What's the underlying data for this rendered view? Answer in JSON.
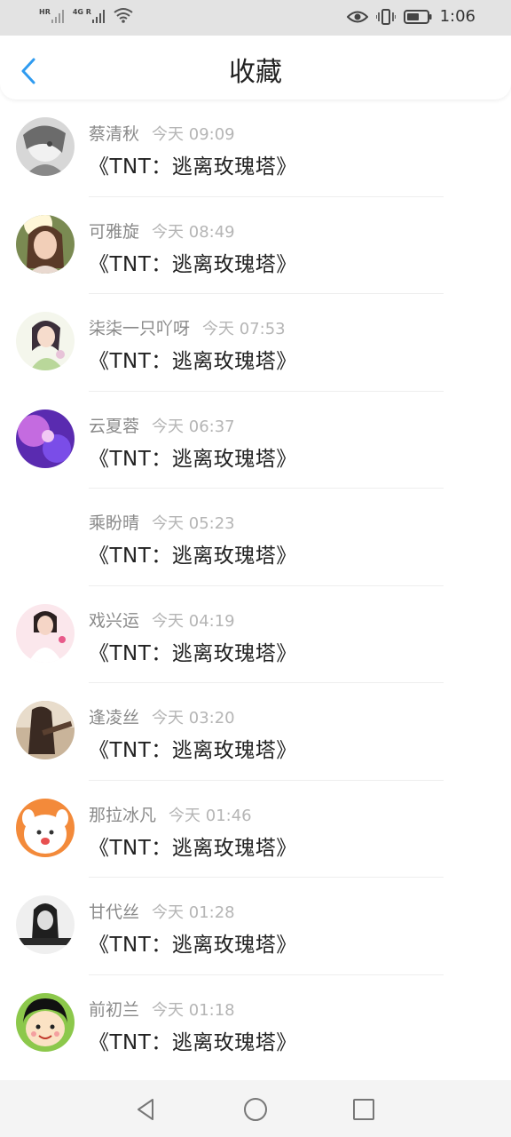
{
  "status": {
    "signal1_label": "HR",
    "signal2_label": "4G R",
    "time": "1:06"
  },
  "header": {
    "title": "收藏"
  },
  "items": [
    {
      "name": "蔡清秋",
      "time": "今天 09:09",
      "book": "《TNT：逃离玫瑰塔》"
    },
    {
      "name": "可雅旋",
      "time": "今天 08:49",
      "book": "《TNT：逃离玫瑰塔》"
    },
    {
      "name": "柒柒一只吖呀",
      "time": "今天 07:53",
      "book": "《TNT：逃离玫瑰塔》"
    },
    {
      "name": "云夏蓉",
      "time": "今天 06:37",
      "book": "《TNT：逃离玫瑰塔》"
    },
    {
      "name": "乘盼晴",
      "time": "今天 05:23",
      "book": "《TNT：逃离玫瑰塔》"
    },
    {
      "name": "戏兴运",
      "time": "今天 04:19",
      "book": "《TNT：逃离玫瑰塔》"
    },
    {
      "name": "逢凌丝",
      "time": "今天 03:20",
      "book": "《TNT：逃离玫瑰塔》"
    },
    {
      "name": "那拉冰凡",
      "time": "今天 01:46",
      "book": "《TNT：逃离玫瑰塔》"
    },
    {
      "name": "甘代丝",
      "time": "今天 01:28",
      "book": "《TNT：逃离玫瑰塔》"
    },
    {
      "name": "前初兰",
      "time": "今天 01:18",
      "book": "《TNT：逃离玫瑰塔》"
    }
  ],
  "colors": {
    "accent": "#2f9bf0"
  }
}
